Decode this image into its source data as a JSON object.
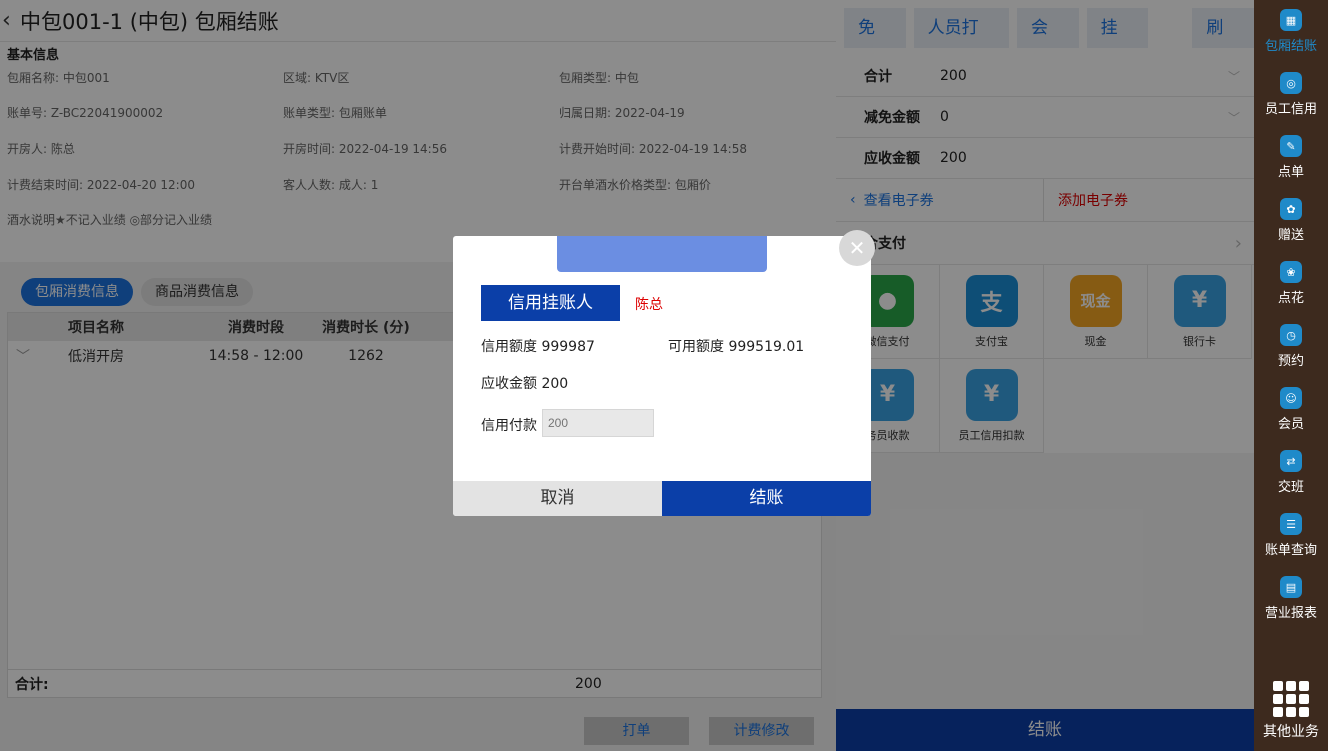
{
  "header": {
    "title": "中包001-1 (中包) 包厢结账"
  },
  "info": {
    "section_title": "基本信息",
    "room_name": "包厢名称: 中包001",
    "area": "区域: KTV区",
    "room_type": "包厢类型: 中包",
    "bill_no": "账单号: Z-BC22041900002",
    "bill_type": "账单类型: 包厢账单",
    "belong_date": "归属日期: 2022-04-19",
    "opener": "开房人: 陈总",
    "open_time": "开房时间: 2022-04-19 14:56",
    "billing_start": "计费开始时间: 2022-04-19 14:58",
    "billing_end": "计费结束时间: 2022-04-20 12:00",
    "guests": "客人人数: 成人: 1",
    "drink_price_type": "开台单酒水价格类型: 包厢价",
    "drink_note": "酒水说明★不记入业绩 ◎部分记入业绩"
  },
  "tabs": [
    {
      "label": "包厢消费信息",
      "active": true
    },
    {
      "label": "商品消费信息",
      "active": false
    }
  ],
  "table": {
    "headers": [
      "项目名称",
      "消费时段",
      "消费时长 (分)"
    ],
    "rows": [
      {
        "name": "低消开房",
        "period": "14:58 - 12:00",
        "duration": "1262"
      }
    ],
    "footer_label": "合计:",
    "footer_value": "200"
  },
  "left_actions": {
    "print": "打单",
    "modify_billing": "计费修改"
  },
  "top_buttons": [
    "免单",
    "人员打折",
    "会员",
    "挂账",
    "刷新"
  ],
  "summary": {
    "total_label": "合计",
    "total_value": "200",
    "discount_label": "减免金额",
    "discount_value": "0",
    "receivable_label": "应收金额",
    "receivable_value": "200"
  },
  "coupons": {
    "view": "查看电子券",
    "add": "添加电子券"
  },
  "payment": {
    "header": "合支付",
    "methods": [
      {
        "label": "微信支付",
        "icon": "wechat-pay-icon",
        "color": "#2aa84a",
        "glyph": "💬"
      },
      {
        "label": "支付宝",
        "icon": "alipay-icon",
        "color": "#1a8fd8",
        "glyph": "支"
      },
      {
        "label": "现金",
        "icon": "cash-icon",
        "color": "#f5a623",
        "glyph": "现金"
      },
      {
        "label": "银行卡",
        "icon": "bank-card-icon",
        "color": "#3aa3e3",
        "glyph": "¥"
      },
      {
        "label": "务员收款",
        "icon": "waiter-collect-icon",
        "color": "#3aa3e3",
        "glyph": "¥"
      },
      {
        "label": "员工信用扣款",
        "icon": "staff-credit-icon",
        "color": "#3aa3e3",
        "glyph": "¥"
      }
    ]
  },
  "checkout_main": "结账",
  "nav": {
    "items": [
      "包厢结账",
      "员工信用",
      "点单",
      "赠送",
      "点花",
      "预约",
      "会员",
      "交班",
      "账单查询",
      "营业报表"
    ],
    "more": "其他业务"
  },
  "modal": {
    "credit_label": "信用挂账人",
    "credit_person": "陈总",
    "credit_limit_label": "信用额度",
    "credit_limit_value": "999987",
    "available_label": "可用额度",
    "available_value": "999519.01",
    "receivable_label": "应收金额",
    "receivable_value": "200",
    "credit_payment_label": "信用付款",
    "credit_payment_placeholder": "200",
    "cancel": "取消",
    "confirm": "结账"
  },
  "colors": {
    "primary_blue": "#0b3fa8",
    "accent_blue": "#1c74e0",
    "danger_red": "#dd0000",
    "nav_brown": "#3d2a1e"
  }
}
